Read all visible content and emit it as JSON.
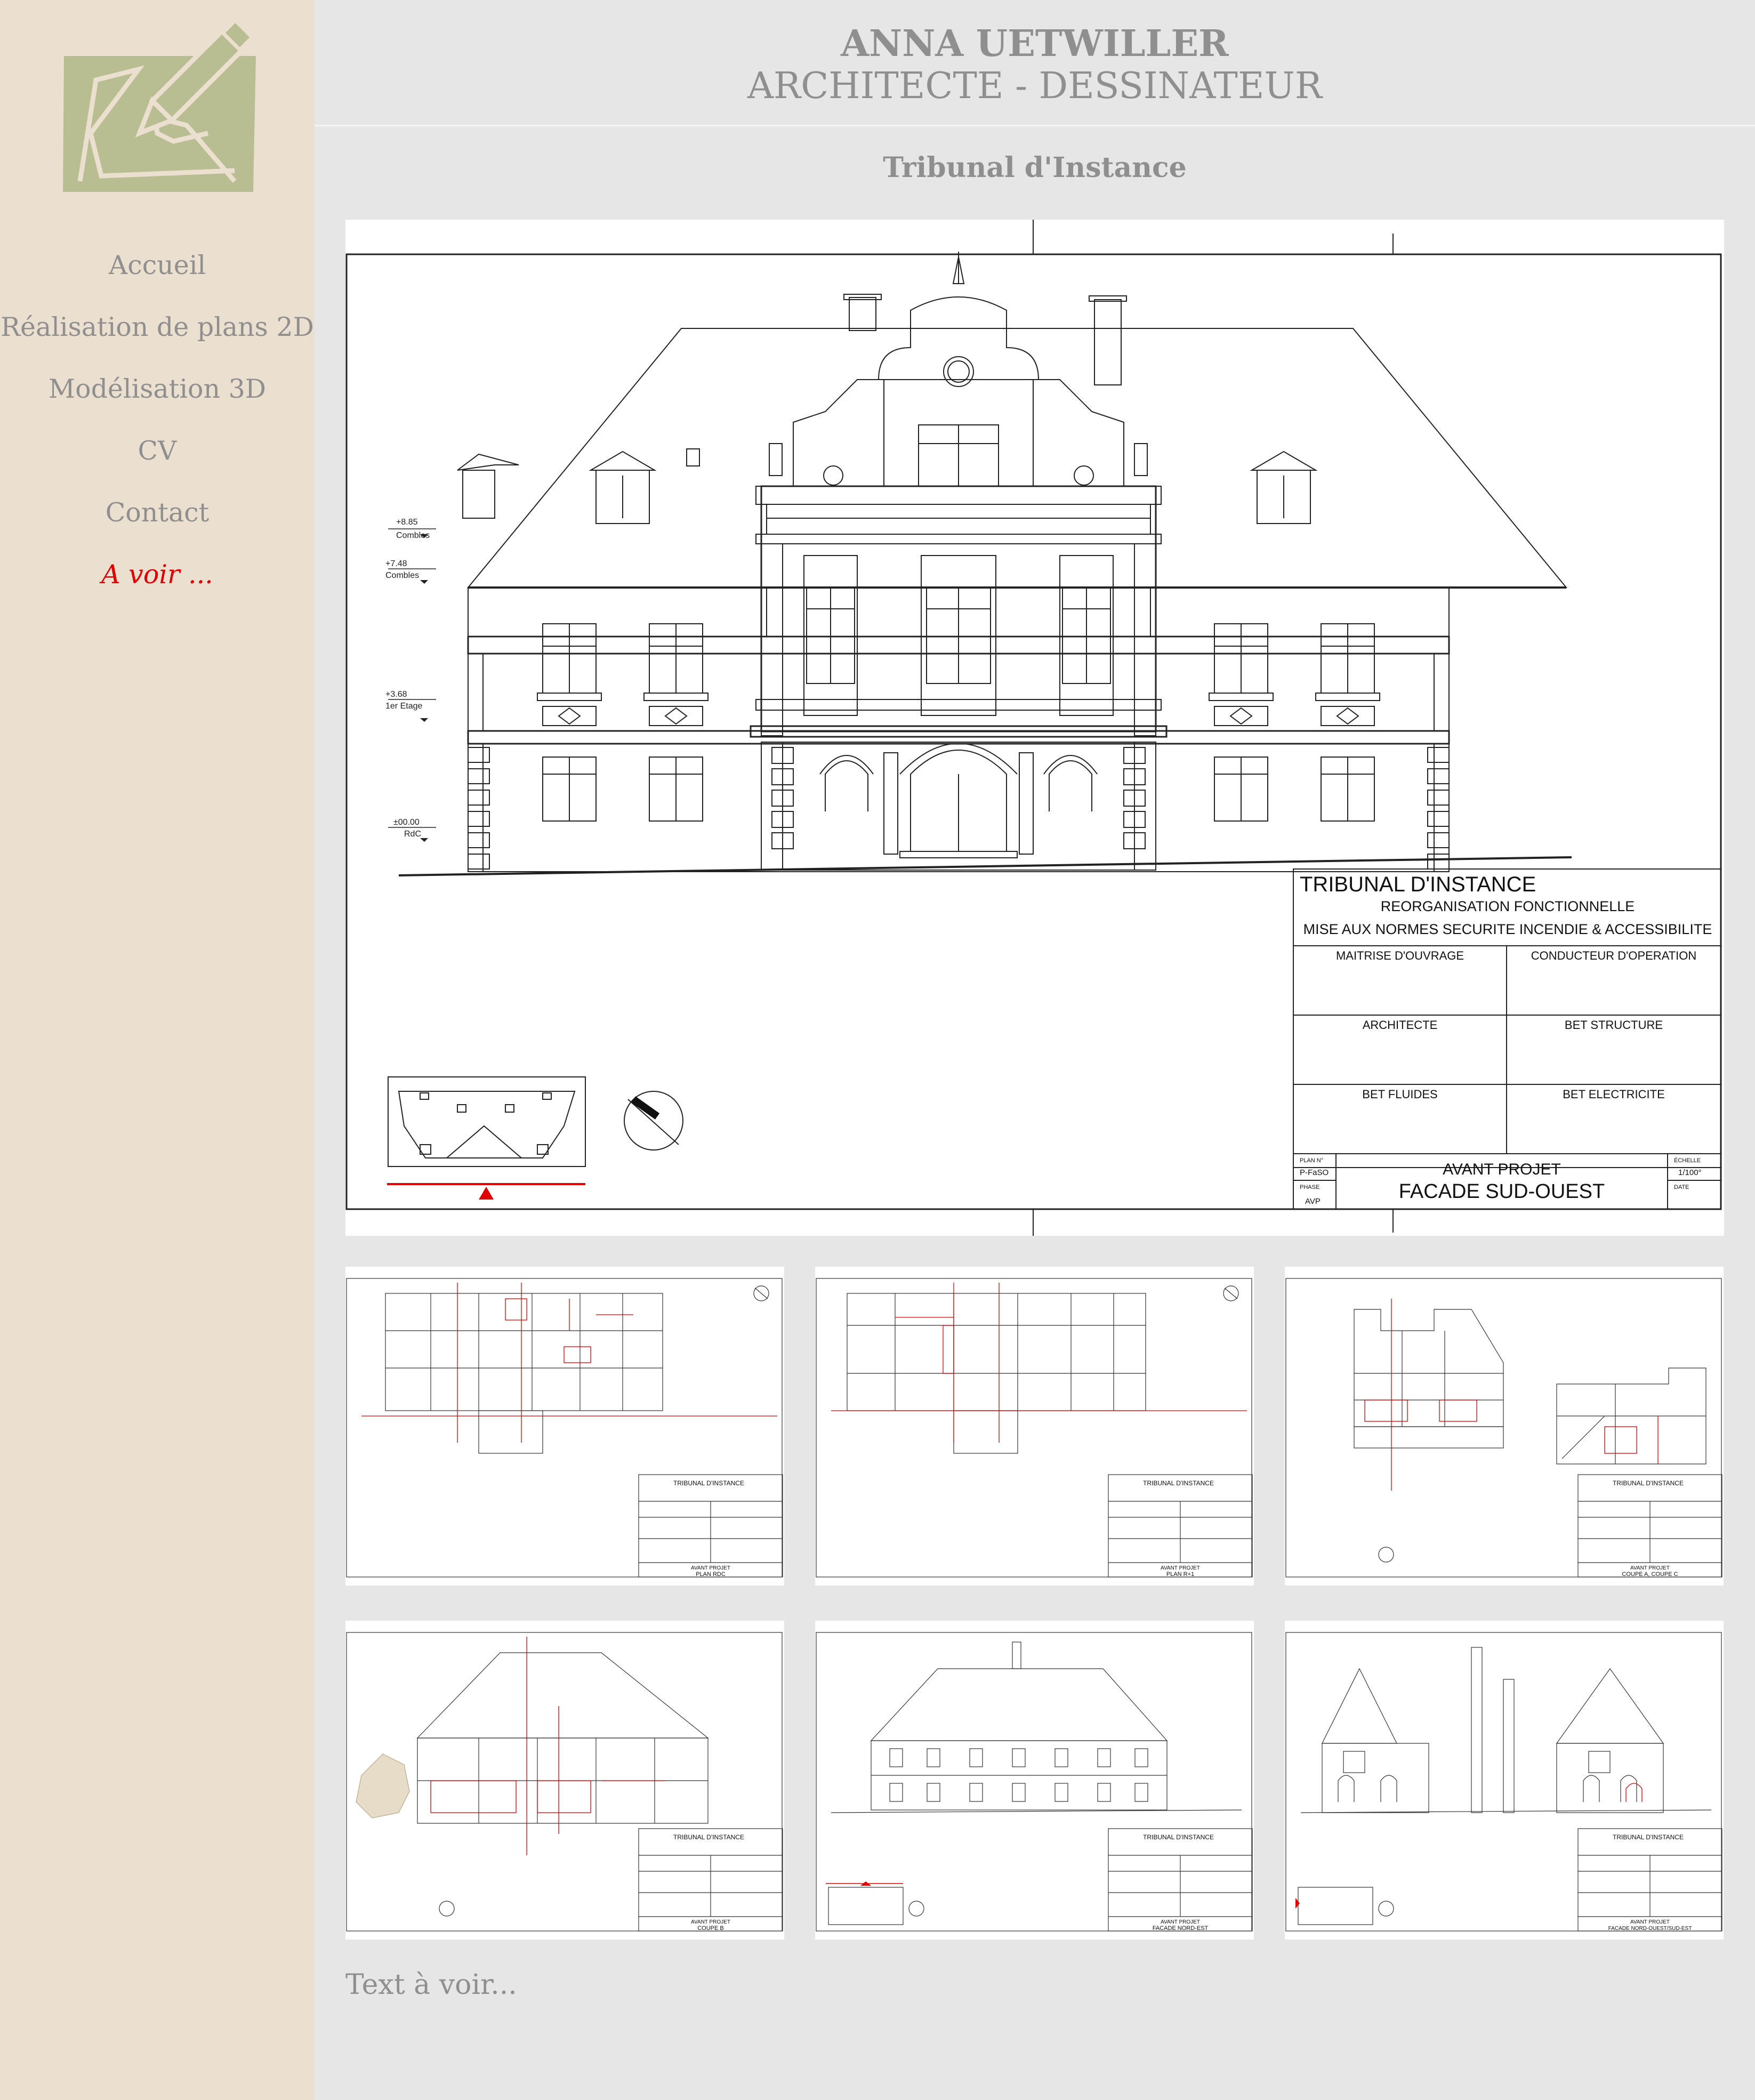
{
  "site": {
    "name": "ANNA UETWILLER",
    "subtitle": "ARCHITECTE - DESSINATEUR"
  },
  "nav": {
    "items": [
      {
        "label": "Accueil"
      },
      {
        "label": "Réalisation de plans 2D"
      },
      {
        "label": "Modélisation 3D"
      },
      {
        "label": "CV"
      },
      {
        "label": "Contact"
      },
      {
        "label": "A voir ..."
      }
    ],
    "active_index": 5
  },
  "page": {
    "title": "Tribunal d'Instance",
    "footer_text": "Text à voir..."
  },
  "colors": {
    "sidebar_bg": "#ebdfd0",
    "content_bg": "#e6e6e6",
    "logo": "#b9bd92",
    "text": "#8f8f8f",
    "active": "#e00000",
    "red_line": "#e00000"
  },
  "main_drawing": {
    "levels": [
      {
        "value": "+8.85",
        "name": "Combles"
      },
      {
        "value": "+7.48",
        "name": "Combles"
      },
      {
        "value": "+3.68",
        "name": "1er Etage"
      },
      {
        "value": "±00.00",
        "name": "RdC"
      }
    ],
    "titleblock": {
      "project": "TRIBUNAL D'INSTANCE",
      "line1": "REORGANISATION FONCTIONNELLE",
      "line2": "MISE AUX NORMES SECURITE INCENDIE & ACCESSIBILITE",
      "roles": [
        "MAITRISE D'OUVRAGE",
        "CONDUCTEUR D'OPERATION",
        "ARCHITECTE",
        "BET STRUCTURE",
        "BET FLUIDES",
        "BET ELECTRICITE"
      ],
      "plan_label": "PLAN N°",
      "plan_no": "P-FaSO",
      "phase_label": "PHASE",
      "phase": "AVP",
      "stage": "AVANT PROJET",
      "view": "FACADE SUD-OUEST",
      "scale_label": "ÉCHELLE",
      "scale": "1/100°",
      "date_label": "DATE"
    }
  },
  "thumbnails": [
    {
      "project": "TRIBUNAL D'INSTANCE",
      "stage": "AVANT PROJET",
      "view": "PLAN RDC"
    },
    {
      "project": "TRIBUNAL D'INSTANCE",
      "stage": "AVANT PROJET",
      "view": "PLAN R+1"
    },
    {
      "project": "TRIBUNAL D'INSTANCE",
      "stage": "AVANT PROJET",
      "view": "COUPE A, COUPE C"
    },
    {
      "project": "TRIBUNAL D'INSTANCE",
      "stage": "AVANT PROJET",
      "view": "COUPE B"
    },
    {
      "project": "TRIBUNAL D'INSTANCE",
      "stage": "AVANT PROJET",
      "view": "FACADE NORD-EST"
    },
    {
      "project": "TRIBUNAL D'INSTANCE",
      "stage": "AVANT PROJET",
      "view": "FACADE NORD-OUEST/SUD-EST"
    }
  ]
}
